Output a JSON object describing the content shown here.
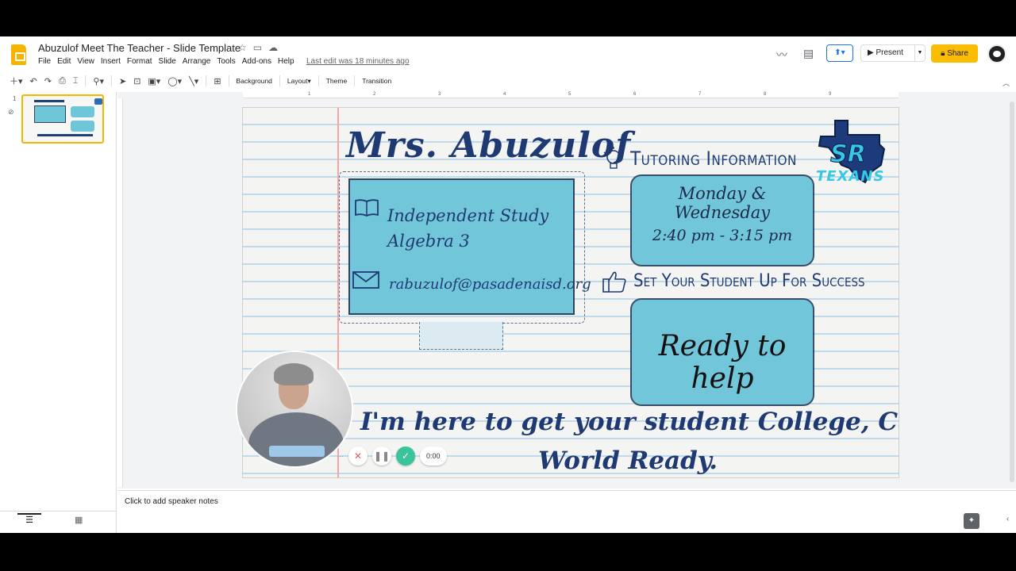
{
  "app": {
    "doc_title": "Abuzulof Meet The Teacher - Slide Template",
    "menu": [
      "File",
      "Edit",
      "View",
      "Insert",
      "Format",
      "Slide",
      "Arrange",
      "Tools",
      "Add-ons",
      "Help"
    ],
    "last_edit": "Last edit was 18 minutes ago",
    "present_label": "Present",
    "share_label": "Share",
    "accent_color": "#fbbc04"
  },
  "toolbar": {
    "background_label": "Background",
    "layout_label": "Layout",
    "theme_label": "Theme",
    "transition_label": "Transition"
  },
  "filmstrip": {
    "slide_number": "1"
  },
  "ruler": {
    "ticks": [
      "1",
      "2",
      "3",
      "4",
      "5",
      "6",
      "7",
      "8",
      "9"
    ]
  },
  "slide": {
    "title": "Mrs. Abuzulof",
    "course_line1": "Independent Study",
    "course_line2": "Algebra 3",
    "email": "rabuzulof@pasadenaisd.org",
    "tutoring_heading": "Tutoring Information",
    "tutoring_days": "Monday & Wednesday",
    "tutoring_time": "2:40 pm - 3:15 pm",
    "success_heading": "Set Your Student Up For Success",
    "success_text": "Ready to help",
    "logo_text": "TEXANS",
    "bottom_line1": "I'm here to get your student College, Career &",
    "bottom_line2": "World Ready."
  },
  "recorder": {
    "time": "0:00"
  },
  "notes": {
    "placeholder": "Click to add speaker notes"
  }
}
